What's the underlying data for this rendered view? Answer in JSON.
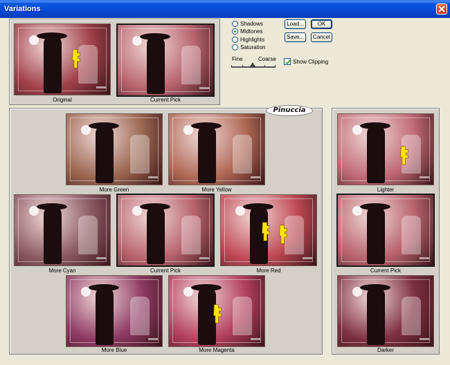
{
  "window": {
    "title": "Variations"
  },
  "top": {
    "original_caption": "Original",
    "current_caption": "Current Pick"
  },
  "range": {
    "options": [
      "Shadows",
      "Midtones",
      "Highlights",
      "Saturation"
    ],
    "selected": "Midtones"
  },
  "slider": {
    "fine_label": "Fine",
    "coarse_label": "Coarse",
    "level": 0.45
  },
  "buttons": {
    "load": "Load...",
    "save": "Save...",
    "ok": "OK",
    "cancel": "Cancel"
  },
  "show_clipping": {
    "label": "Show Clipping",
    "checked": true
  },
  "logo": "Pinuccia",
  "variations": {
    "more_green": "More Green",
    "more_yellow": "More Yellow",
    "more_cyan": "More Cyan",
    "current_pick": "Current Pick",
    "more_red": "More Red",
    "more_blue": "More Blue",
    "more_magenta": "More Magenta"
  },
  "brightness": {
    "lighter": "Lighter",
    "current_pick": "Current Pick",
    "darker": "Darker"
  },
  "colors": {
    "original": "#a0404a",
    "current": "#b8646e",
    "green": "#9a6650",
    "yellow": "#b06a56",
    "cyan": "#8a5a62",
    "red": "#c04a56",
    "blue": "#8e3a62",
    "magenta": "#b3405e",
    "lighter": "#c06a76",
    "darker": "#7e3040"
  }
}
